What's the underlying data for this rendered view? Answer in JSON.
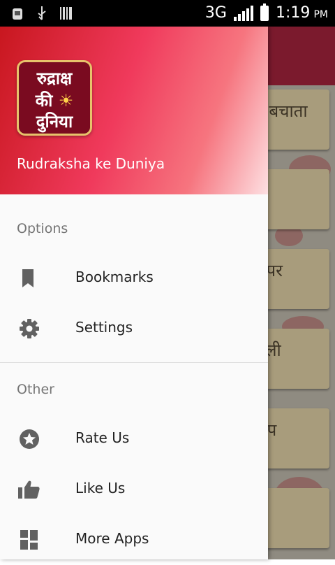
{
  "status_bar": {
    "network": "3G",
    "time": "1:19",
    "ampm": "PM"
  },
  "drawer": {
    "logo_lines": [
      "रुद्राक्ष",
      "की",
      "☀",
      "दुनिया"
    ],
    "app_name": "Rudraksha ke Duniya",
    "sections": [
      {
        "label": "Options",
        "items": [
          {
            "label": "Bookmarks",
            "icon": "bookmark-icon"
          },
          {
            "label": "Settings",
            "icon": "gear-icon"
          }
        ]
      },
      {
        "label": "Other",
        "items": [
          {
            "label": "Rate Us",
            "icon": "star-icon"
          },
          {
            "label": "Like Us",
            "icon": "thumbs-up-icon"
          },
          {
            "label": "More Apps",
            "icon": "apps-grid-icon"
          }
        ]
      }
    ]
  },
  "background_cards": [
    "ष बचाता",
    "",
    "र पर",
    "सली",
    "रूप",
    ""
  ],
  "colors": {
    "header_start": "#c8171f",
    "header_mid": "#f03a5c",
    "icon": "#616161",
    "text": "#222222"
  }
}
